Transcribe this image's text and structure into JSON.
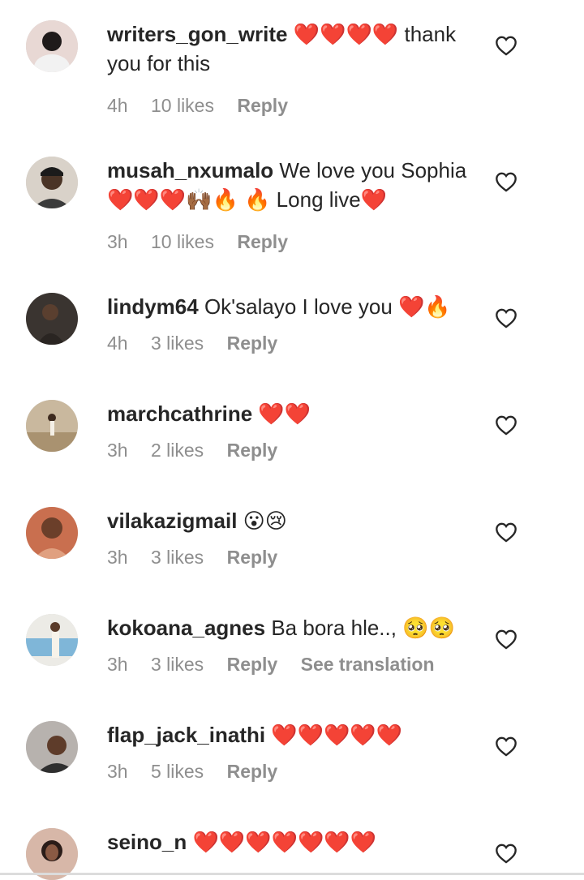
{
  "comments": [
    {
      "username": "writers_gon_write",
      "text": "❤️❤️❤️❤️ thank you for this",
      "time": "4h",
      "likes": "10 likes",
      "reply": "Reply",
      "translate": "",
      "avatar_icon": "profile-photo",
      "avatar_color": "#e8d8d4"
    },
    {
      "username": "musah_nxumalo",
      "text": "We love you Sophia ❤️❤️❤️🙌🏾🔥 🔥 Long live❤️",
      "time": "3h",
      "likes": "10 likes",
      "reply": "Reply",
      "translate": "",
      "avatar_icon": "profile-photo",
      "avatar_color": "#d9d2c9"
    },
    {
      "username": "lindym64",
      "text": "Ok'salayo I love you ❤️🔥",
      "time": "4h",
      "likes": "3 likes",
      "reply": "Reply",
      "translate": "",
      "avatar_icon": "profile-photo",
      "avatar_color": "#3a3430"
    },
    {
      "username": "marchcathrine",
      "text": "❤️❤️",
      "time": "3h",
      "likes": "2 likes",
      "reply": "Reply",
      "translate": "",
      "avatar_icon": "profile-photo",
      "avatar_color": "#c9b89e"
    },
    {
      "username": "vilakazigmail",
      "text": "😮😢",
      "time": "3h",
      "likes": "3 likes",
      "reply": "Reply",
      "translate": "",
      "avatar_icon": "profile-photo",
      "avatar_color": "#c96f4f"
    },
    {
      "username": "kokoana_agnes",
      "text": "Ba bora hle.., 🥺🥺",
      "time": "3h",
      "likes": "3 likes",
      "reply": "Reply",
      "translate": "See translation",
      "avatar_icon": "profile-photo",
      "avatar_color": "#7fb6d8"
    },
    {
      "username": "flap_jack_inathi",
      "text": "❤️❤️❤️❤️❤️",
      "time": "3h",
      "likes": "5 likes",
      "reply": "Reply",
      "translate": "",
      "avatar_icon": "profile-photo",
      "avatar_color": "#b7b2ae"
    },
    {
      "username": "seino_n",
      "text": "❤️❤️❤️❤️❤️❤️❤️",
      "time": "",
      "likes": "",
      "reply": "",
      "translate": "",
      "avatar_icon": "profile-photo",
      "avatar_color": "#d7b7a8"
    }
  ],
  "like_icon": "heart-outline-icon",
  "colors": {
    "text": "#262626",
    "meta": "#8e8e8e",
    "background": "#ffffff"
  }
}
